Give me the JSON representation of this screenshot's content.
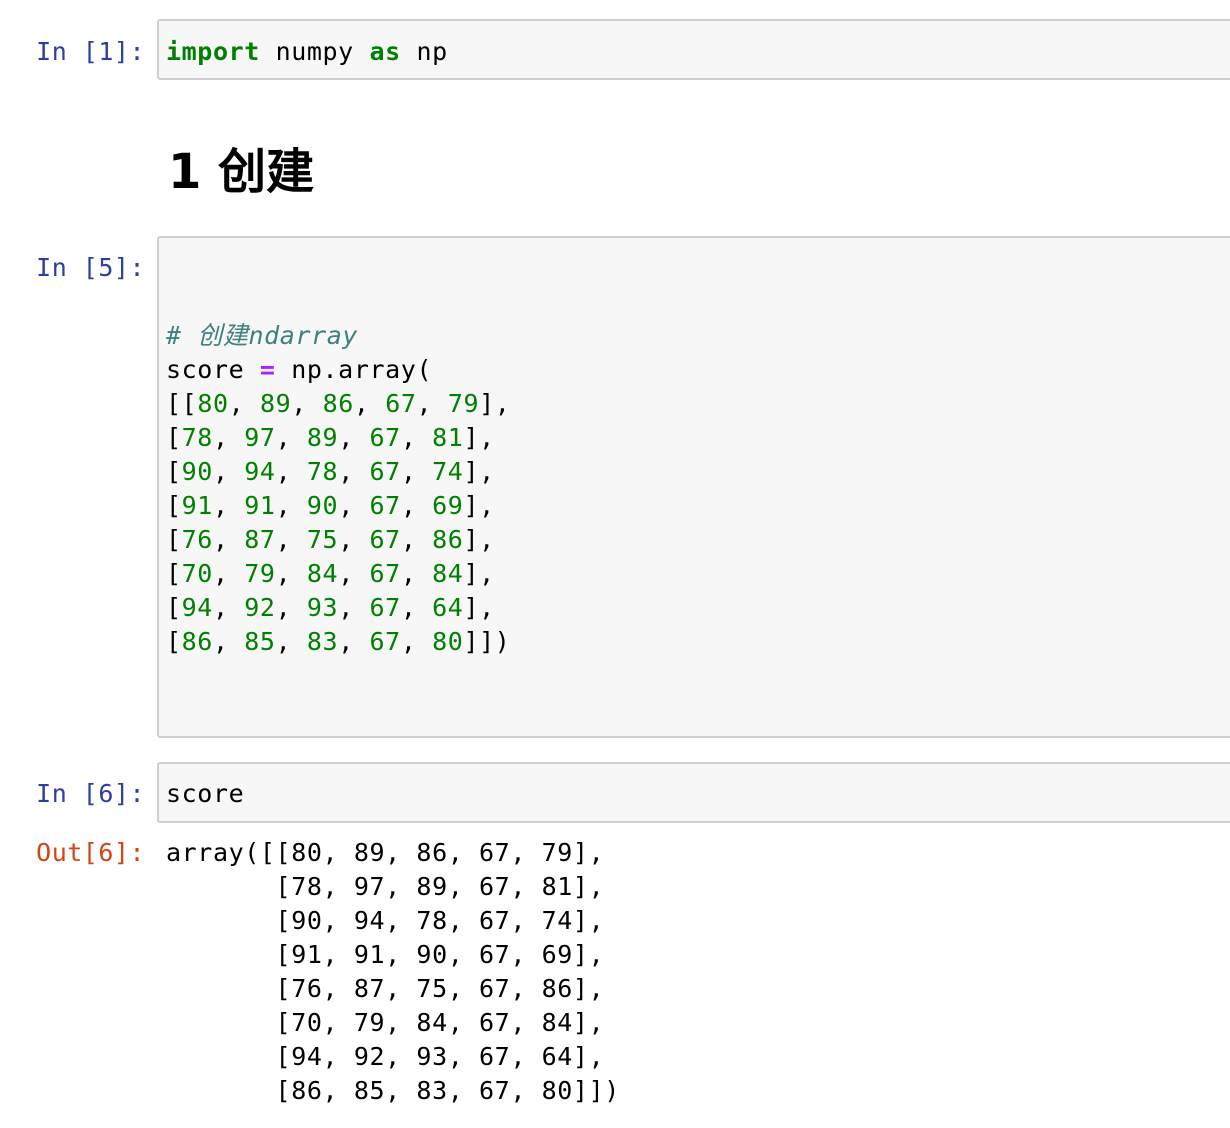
{
  "cells": [
    {
      "prompt": "In [1]:",
      "code": {
        "kw1": "import",
        "mid": " numpy ",
        "kw2": "as",
        "tail": " np"
      }
    },
    {
      "type": "markdown",
      "heading": "1 创建"
    },
    {
      "prompt": "In [5]:",
      "comment": "# 创建ndarray",
      "line_head": "score ",
      "assign_op": "=",
      "line_tail": " np.array(",
      "rows": [
        [
          "80",
          "89",
          "86",
          "67",
          "79"
        ],
        [
          "78",
          "97",
          "89",
          "67",
          "81"
        ],
        [
          "90",
          "94",
          "78",
          "67",
          "74"
        ],
        [
          "91",
          "91",
          "90",
          "67",
          "69"
        ],
        [
          "76",
          "87",
          "75",
          "67",
          "86"
        ],
        [
          "70",
          "79",
          "84",
          "67",
          "84"
        ],
        [
          "94",
          "92",
          "93",
          "67",
          "64"
        ],
        [
          "86",
          "85",
          "83",
          "67",
          "80"
        ]
      ]
    },
    {
      "prompt": "In [6]:",
      "code": "score",
      "out_prompt": "Out[6]:",
      "output": "array([[80, 89, 86, 67, 79],\n       [78, 97, 89, 67, 81],\n       [90, 94, 78, 67, 74],\n       [91, 91, 90, 67, 69],\n       [76, 87, 75, 67, 86],\n       [70, 79, 84, 67, 84],\n       [94, 92, 93, 67, 64],\n       [86, 85, 83, 67, 80]])"
    }
  ],
  "colors": {
    "prompt_in": "#303f9f",
    "prompt_out": "#d84315",
    "keyword": "#008000",
    "number": "#008000",
    "operator": "#aa22ff",
    "comment": "#408080",
    "cell_background": "#f7f7f7",
    "cell_border": "#cfcfcf"
  }
}
